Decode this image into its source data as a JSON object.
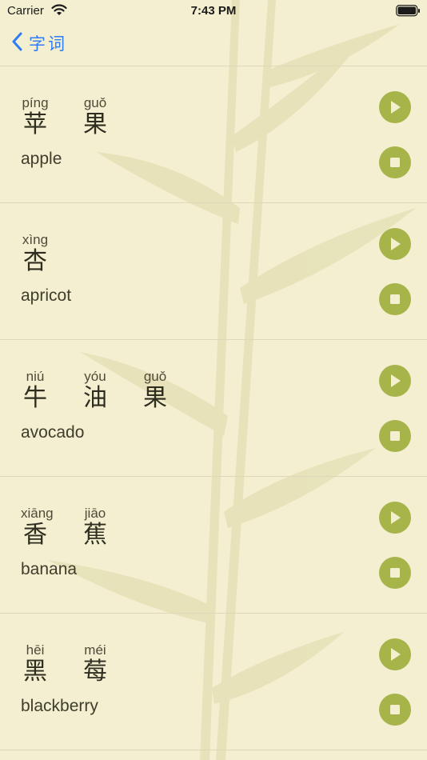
{
  "status_bar": {
    "carrier": "Carrier",
    "time": "7:43 PM"
  },
  "nav": {
    "back_label": "字词"
  },
  "colors": {
    "background": "#f3efd0",
    "accent": "#a6b44a",
    "back_tint": "#2f7cf6"
  },
  "words": [
    {
      "chars": [
        {
          "pinyin": "píng",
          "hanzi": "苹"
        },
        {
          "pinyin": "guǒ",
          "hanzi": "果"
        }
      ],
      "english": "apple"
    },
    {
      "chars": [
        {
          "pinyin": "xìng",
          "hanzi": "杏"
        }
      ],
      "english": "apricot"
    },
    {
      "chars": [
        {
          "pinyin": "niú",
          "hanzi": "牛"
        },
        {
          "pinyin": "yóu",
          "hanzi": "油"
        },
        {
          "pinyin": "guǒ",
          "hanzi": "果"
        }
      ],
      "english": "avocado"
    },
    {
      "chars": [
        {
          "pinyin": "xiāng",
          "hanzi": "香"
        },
        {
          "pinyin": "jiāo",
          "hanzi": "蕉"
        }
      ],
      "english": "banana"
    },
    {
      "chars": [
        {
          "pinyin": "hēi",
          "hanzi": "黑"
        },
        {
          "pinyin": "méi",
          "hanzi": "莓"
        }
      ],
      "english": "blackberry"
    }
  ],
  "icons": {
    "play": "play-icon",
    "stop": "stop-icon",
    "back": "chevron-left-icon"
  }
}
